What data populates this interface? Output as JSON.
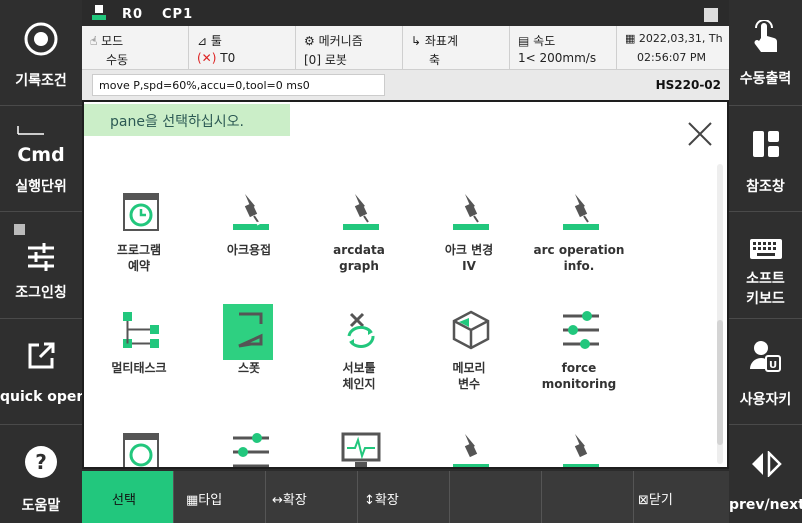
{
  "topbar": {
    "robot": "R0",
    "cp": "CP1"
  },
  "status": {
    "mode_label": "모드",
    "mode_value": "수동",
    "tool_label": "툴",
    "tool_value": "T0",
    "mech_label": "메커니즘",
    "mech_value": "[0] 로봇",
    "coord_label": "좌표계",
    "coord_value": "축",
    "speed_label": "속도",
    "speed_value": "1< 200mm/s",
    "date": "2022,03,31, Th",
    "time": "02:56:07 PM"
  },
  "command": {
    "text": "move P,spd=60%,accu=0,tool=0 ms0",
    "model": "HS220-02"
  },
  "pane": {
    "hint": "pane을 선택하십시오.",
    "items": [
      {
        "label": "프로그램\n예약",
        "icon": "schedule-icon"
      },
      {
        "label": "아크용접",
        "icon": "arc-torch-icon"
      },
      {
        "label": "arcdata\ngraph",
        "icon": "arc-torch-icon"
      },
      {
        "label": "아크 변경\nIV",
        "icon": "arc-torch-icon"
      },
      {
        "label": "arc operation\ninfo.",
        "icon": "arc-torch-icon"
      },
      {
        "label": "멀티태스크",
        "icon": "multitask-icon"
      },
      {
        "label": "스폿",
        "icon": "spot-icon"
      },
      {
        "label": "서보툴\n체인지",
        "icon": "servo-tool-icon"
      },
      {
        "label": "메모리\n변수",
        "icon": "memory-cube-icon"
      },
      {
        "label": "force\nmonitoring",
        "icon": "sliders-icon"
      }
    ]
  },
  "left_panel": {
    "record": "기록조건",
    "cmd_title": "Cmd",
    "cmd_sub": "실행단위",
    "jog": "조그인칭",
    "quick": "quick open",
    "help": "도움말"
  },
  "right_panel": {
    "manual": "수동출력",
    "ref": "참조창",
    "kbd1": "소프트",
    "kbd2": "키보드",
    "user": "사용자키",
    "prev": "prev/next"
  },
  "bottom": {
    "select": "선택",
    "type": "타입",
    "hexpand": "확장",
    "vexpand": "확장",
    "close": "닫기"
  },
  "colors": {
    "accent": "#22c77d",
    "highlight": "#2ed081",
    "hint_bg": "#cbeec8"
  }
}
